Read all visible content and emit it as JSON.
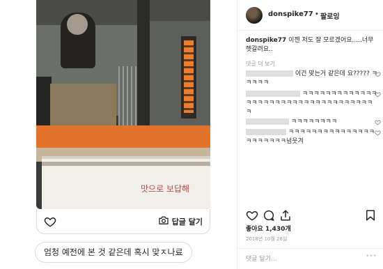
{
  "story": {
    "box_text": "맛으로 보답해",
    "reply_label": "답글 달기",
    "dm_message": "엄청 예전에 본 것 같은데 혹시 맞ㅈ나료"
  },
  "post": {
    "username": "donspike77",
    "follow_label": "팔로잉",
    "header_separator": "•",
    "caption_text": "이젠 저도 잘 모르겠어요.....너무 헷갈려요..",
    "caption_meta": "댓글 더 보기",
    "comments": [
      {
        "text": "이건 맞는거 같은데 요????? ㅋㅋㅋㅋㅋ"
      },
      {
        "text": "ㅋㅋㅋㅋㅋㅋㅋㅋㅋㅋㅋㅋㅋㅋㅋㅋㅋㅋㅋㅋㅋㅋㅋㅋㅋㅋㅋㅋㅋㅋㅋㅋㅋㅋㅋㅋ"
      },
      {
        "text": "ㅋㅋㅋㅋㅋㅋㅋㅋ"
      },
      {
        "text": "ㅋㅋㅋㅋㅋㅋㅋㅋㅋㅋㅋㅋㅋㅋㅋㅋㅋㅋㅋㅋㅋㅋ넘웃겨"
      }
    ],
    "likes_text": "좋아요 1,430개",
    "date": "2018년 10월 28일",
    "comment_placeholder": "댓글 달기...",
    "more_dots": "•••"
  },
  "icons": {
    "heart": "heart-icon",
    "camera": "camera-icon",
    "comment": "comment-icon",
    "share": "share-icon",
    "bookmark": "bookmark-icon"
  },
  "colors": {
    "orange_band": "#e3732b",
    "text": "#262626",
    "muted": "#999999",
    "border": "#dbdbdb"
  }
}
